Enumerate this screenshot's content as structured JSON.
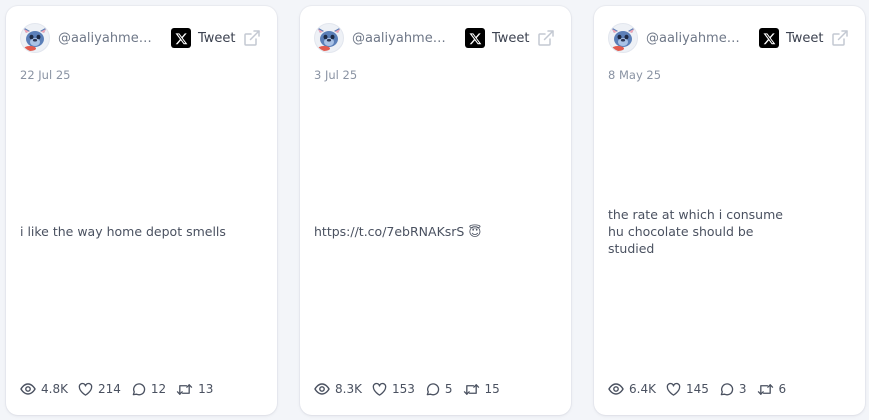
{
  "cards": [
    {
      "handle": "@aaliyahmen...",
      "tweet_label": "Tweet",
      "date": "22 Jul 25",
      "text": "i like the way home depot smells",
      "emoji": "",
      "views": "4.8K",
      "likes": "214",
      "replies": "12",
      "retweets": "13"
    },
    {
      "handle": "@aaliyahmen...",
      "tweet_label": "Tweet",
      "date": "3 Jul 25",
      "text": "https://t.co/7ebRNAKsrS",
      "emoji": "😇",
      "views": "8.3K",
      "likes": "153",
      "replies": "5",
      "retweets": "15"
    },
    {
      "handle": "@aaliyahmen...",
      "tweet_label": "Tweet",
      "date": "8 May 25",
      "text": "the rate at which i consume hu chocolate should be studied",
      "emoji": "",
      "views": "6.4K",
      "likes": "145",
      "replies": "3",
      "retweets": "6"
    }
  ],
  "icons": {
    "avatar": "stitch-avatar-icon",
    "platform": "x-logo-icon",
    "external": "external-link-icon",
    "views": "eye-icon",
    "likes": "heart-icon",
    "replies": "comment-icon",
    "retweets": "retweet-icon"
  },
  "colors": {
    "background": "#f3f5f9",
    "card": "#ffffff",
    "muted_text": "#8a93a3",
    "body_text": "#4a5160",
    "x_logo": "#000000"
  }
}
